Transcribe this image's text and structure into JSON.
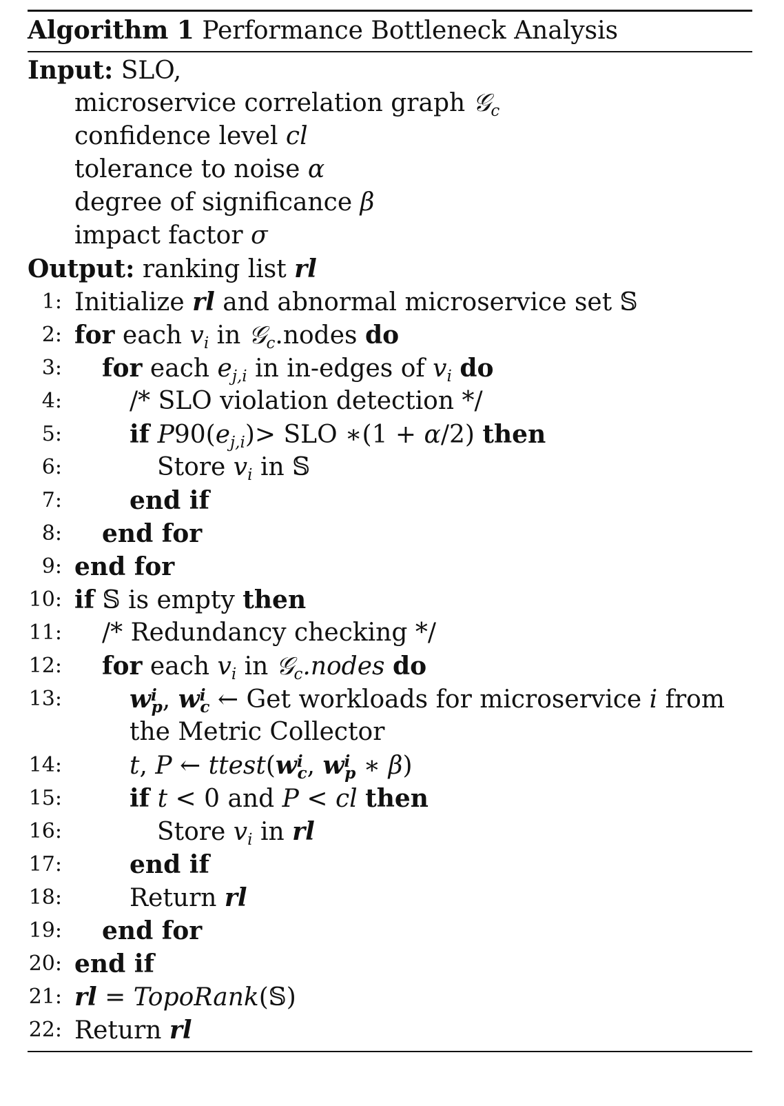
{
  "algorithm": {
    "label": "Algorithm 1",
    "title": "Performance Bottleneck Analysis",
    "input_label": "Input:",
    "output_label": "Output:",
    "inputs": [
      "SLO,",
      "microservice correlation graph",
      "confidence level",
      "tolerance to noise",
      "degree of significance",
      "impact factor"
    ],
    "input_symbols": [
      "",
      "𝒢",
      "cl",
      "α",
      "β",
      "σ"
    ],
    "output_text": "ranking list",
    "output_symbol": "rl",
    "line_numbers": [
      "1:",
      "2:",
      "3:",
      "4:",
      "5:",
      "6:",
      "7:",
      "8:",
      "9:",
      "10:",
      "11:",
      "12:",
      "13:",
      "14:",
      "15:",
      "16:",
      "17:",
      "18:",
      "19:",
      "20:",
      "21:",
      "22:"
    ],
    "text": {
      "initialize": "Initialize",
      "and_abnormal": "and abnormal microservice set",
      "for": "for",
      "each": "each",
      "in": "in",
      "nodes": ".nodes",
      "do": "do",
      "in_edges_of": "in in-edges of",
      "slo_comment": "/* SLO violation detection */",
      "if": "if",
      "slo_expr": "SLO",
      "then": "then",
      "store": "Store",
      "end_if": "end if",
      "end_for": "end for",
      "is_empty": "is empty",
      "redundancy_comment": "/* Redundancy checking */",
      "nodes_italic": ".nodes",
      "get_workloads": "Get workloads for microservice",
      "from": "from",
      "metric_collector": "the Metric Collector",
      "ttest": "ttest",
      "and": "and",
      "return": "Return",
      "toporank": "TopoRank"
    }
  }
}
